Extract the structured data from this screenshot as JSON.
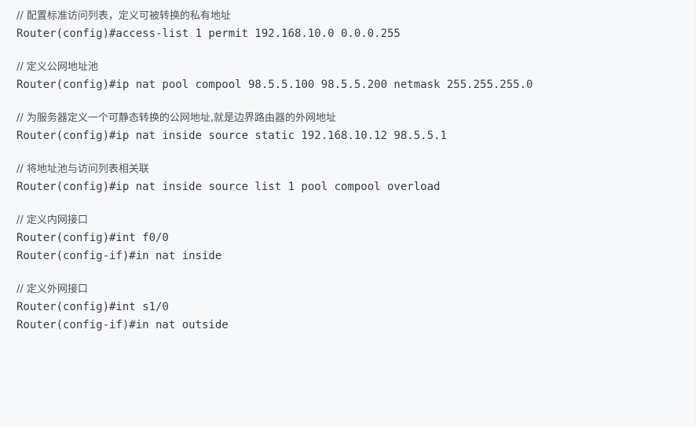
{
  "code": {
    "lines": [
      {
        "text": "// 配置标准访问列表，定义可被转换的私有地址",
        "kind": "comment"
      },
      {
        "text": "Router(config)#access-list 1 permit 192.168.10.0 0.0.0.255",
        "kind": "code"
      },
      {
        "text": "",
        "kind": "blank"
      },
      {
        "text": "// 定义公网地址池",
        "kind": "comment"
      },
      {
        "text": "Router(config)#ip nat pool compool 98.5.5.100 98.5.5.200 netmask 255.255.255.0",
        "kind": "code"
      },
      {
        "text": "",
        "kind": "blank"
      },
      {
        "text": "// 为服务器定义一个可静态转换的公网地址,就是边界路由器的外网地址",
        "kind": "comment"
      },
      {
        "text": "Router(config)#ip nat inside source static 192.168.10.12 98.5.5.1",
        "kind": "code"
      },
      {
        "text": "",
        "kind": "blank"
      },
      {
        "text": "// 将地址池与访问列表相关联",
        "kind": "comment"
      },
      {
        "text": "Router(config)#ip nat inside source list 1 pool compool overload",
        "kind": "code"
      },
      {
        "text": "",
        "kind": "blank"
      },
      {
        "text": "// 定义内网接口",
        "kind": "comment"
      },
      {
        "text": "Router(config)#int f0/0",
        "kind": "code"
      },
      {
        "text": "Router(config-if)#in nat inside",
        "kind": "code"
      },
      {
        "text": "",
        "kind": "blank"
      },
      {
        "text": "// 定义外网接口",
        "kind": "comment"
      },
      {
        "text": "Router(config)#int s1/0",
        "kind": "code"
      },
      {
        "text": "Router(config-if)#in nat outside",
        "kind": "code"
      }
    ]
  }
}
